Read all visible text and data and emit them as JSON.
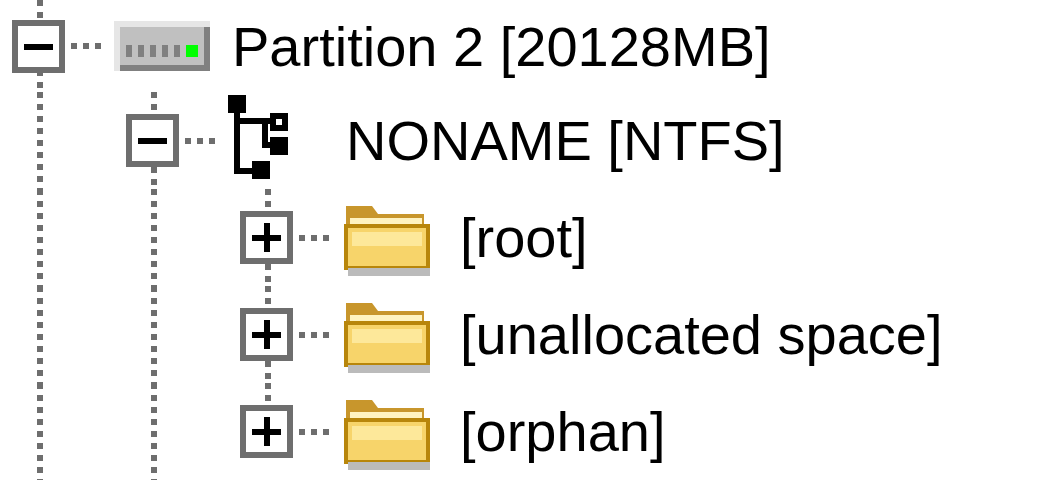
{
  "tree": [
    {
      "kind": "disk",
      "label": "Partition 2 [20128MB]",
      "expanded": true,
      "children": [
        {
          "kind": "volume",
          "label": "NONAME [NTFS]",
          "expanded": true,
          "children": [
            {
              "kind": "folder",
              "label": "[root]",
              "expanded": false
            },
            {
              "kind": "folder",
              "label": "[unallocated space]",
              "expanded": false
            },
            {
              "kind": "folder",
              "label": "[orphan]",
              "expanded": false
            }
          ]
        }
      ]
    }
  ]
}
